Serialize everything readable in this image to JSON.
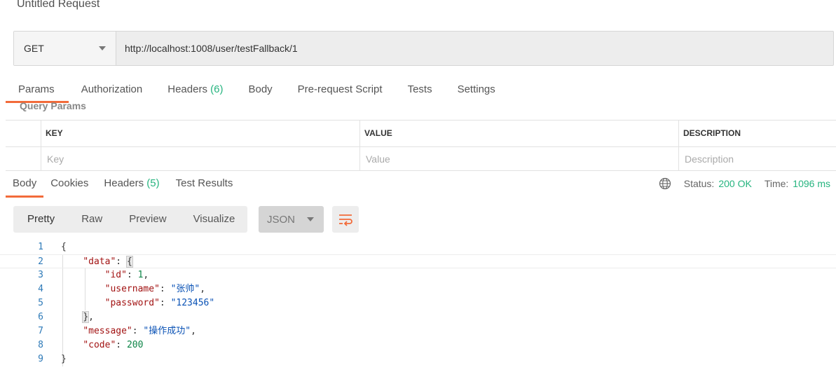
{
  "request": {
    "title": "Untitled Request",
    "method": "GET",
    "url": "http://localhost:1008/user/testFallback/1"
  },
  "request_tabs": [
    {
      "label": "Params",
      "count": ""
    },
    {
      "label": "Authorization",
      "count": ""
    },
    {
      "label": "Headers",
      "count": "(6)"
    },
    {
      "label": "Body",
      "count": ""
    },
    {
      "label": "Pre-request Script",
      "count": ""
    },
    {
      "label": "Tests",
      "count": ""
    },
    {
      "label": "Settings",
      "count": ""
    }
  ],
  "query_params": {
    "label": "Query Params",
    "columns": [
      "KEY",
      "VALUE",
      "DESCRIPTION"
    ],
    "placeholders": {
      "key": "Key",
      "value": "Value",
      "description": "Description"
    }
  },
  "response_tabs": [
    {
      "label": "Body",
      "count": ""
    },
    {
      "label": "Cookies",
      "count": ""
    },
    {
      "label": "Headers",
      "count": "(5)"
    },
    {
      "label": "Test Results",
      "count": ""
    }
  ],
  "response_status": {
    "globe_icon": "globe-icon",
    "status_label": "Status:",
    "status_value": "200 OK",
    "time_label": "Time:",
    "time_value": "1096 ms"
  },
  "view_modes": [
    "Pretty",
    "Raw",
    "Preview",
    "Visualize"
  ],
  "format": "JSON",
  "wrap_icon": "wrap-lines-icon",
  "colors": {
    "accent": "#f26b3a",
    "success": "#26b47f",
    "key": "#a21313",
    "string": "#0a52b5",
    "number": "#0d8547",
    "line_number": "#2e7ab8"
  },
  "code_lines": [
    {
      "num": "1",
      "tokens": [
        {
          "t": "p",
          "v": "{"
        }
      ]
    },
    {
      "num": "2",
      "tokens": [
        {
          "t": "p",
          "v": "    "
        },
        {
          "t": "k",
          "v": "\"data\""
        },
        {
          "t": "p",
          "v": ": "
        },
        {
          "t": "b",
          "v": "{"
        }
      ]
    },
    {
      "num": "3",
      "tokens": [
        {
          "t": "p",
          "v": "        "
        },
        {
          "t": "k",
          "v": "\"id\""
        },
        {
          "t": "p",
          "v": ": "
        },
        {
          "t": "n",
          "v": "1"
        },
        {
          "t": "p",
          "v": ","
        }
      ]
    },
    {
      "num": "4",
      "tokens": [
        {
          "t": "p",
          "v": "        "
        },
        {
          "t": "k",
          "v": "\"username\""
        },
        {
          "t": "p",
          "v": ": "
        },
        {
          "t": "s",
          "v": "\"张帅\""
        },
        {
          "t": "p",
          "v": ","
        }
      ]
    },
    {
      "num": "5",
      "tokens": [
        {
          "t": "p",
          "v": "        "
        },
        {
          "t": "k",
          "v": "\"password\""
        },
        {
          "t": "p",
          "v": ": "
        },
        {
          "t": "s",
          "v": "\"123456\""
        }
      ]
    },
    {
      "num": "6",
      "tokens": [
        {
          "t": "p",
          "v": "    "
        },
        {
          "t": "b",
          "v": "}"
        },
        {
          "t": "p",
          "v": ","
        }
      ]
    },
    {
      "num": "7",
      "tokens": [
        {
          "t": "p",
          "v": "    "
        },
        {
          "t": "k",
          "v": "\"message\""
        },
        {
          "t": "p",
          "v": ": "
        },
        {
          "t": "s",
          "v": "\"操作成功\""
        },
        {
          "t": "p",
          "v": ","
        }
      ]
    },
    {
      "num": "8",
      "tokens": [
        {
          "t": "p",
          "v": "    "
        },
        {
          "t": "k",
          "v": "\"code\""
        },
        {
          "t": "p",
          "v": ": "
        },
        {
          "t": "n",
          "v": "200"
        }
      ]
    },
    {
      "num": "9",
      "tokens": [
        {
          "t": "p",
          "v": "}"
        }
      ]
    }
  ]
}
